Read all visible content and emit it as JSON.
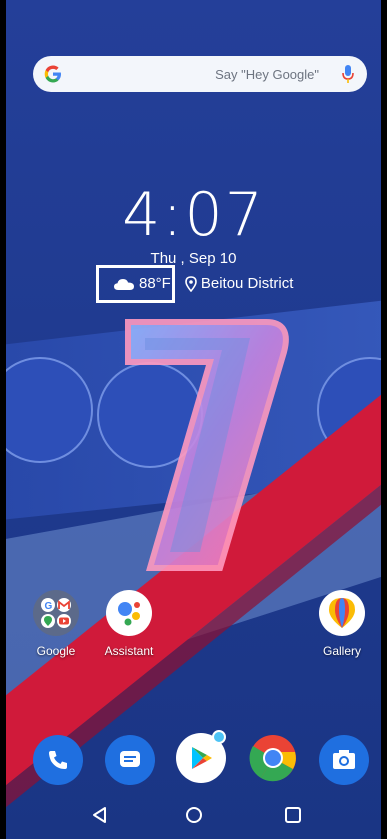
{
  "search": {
    "hint": "Say \"Hey Google\""
  },
  "clock": {
    "time": "4:07",
    "date": "Thu , Sep 10"
  },
  "weather": {
    "temperature": "88°F",
    "location": "Beitou District",
    "condition_icon": "cloud-icon"
  },
  "home_apps": [
    {
      "label": "Google",
      "icon": "google-folder-icon"
    },
    {
      "label": "Assistant",
      "icon": "assistant-icon"
    },
    {
      "label": "Gallery",
      "icon": "gallery-icon"
    }
  ],
  "dock": [
    {
      "icon": "phone-icon"
    },
    {
      "icon": "messages-icon"
    },
    {
      "icon": "play-store-icon"
    },
    {
      "icon": "chrome-icon"
    },
    {
      "icon": "camera-icon"
    }
  ],
  "navigation": [
    {
      "icon": "back-icon"
    },
    {
      "icon": "home-icon"
    },
    {
      "icon": "recents-icon"
    }
  ],
  "colors": {
    "wallpaper_blue": "#1c3a8f",
    "accent_red": "#d01a3a",
    "dock_blue": "#1f6fe0"
  }
}
